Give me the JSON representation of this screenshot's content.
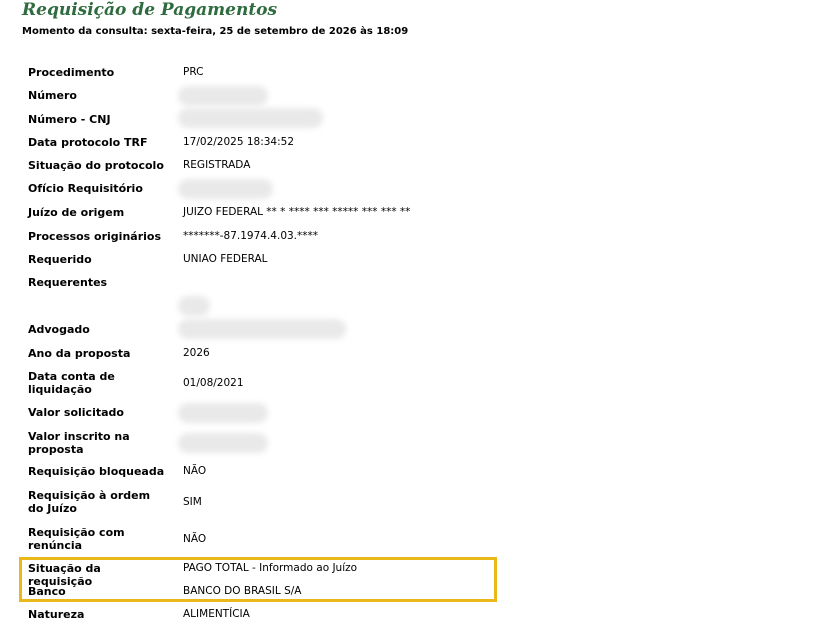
{
  "header": {
    "title": "Requisição de Pagamentos",
    "consulta": "Momento da consulta: sexta-feira, 25 de setembro de 2026 às 18:09"
  },
  "fields": {
    "procedimento": {
      "label": "Procedimento",
      "value": "PRC"
    },
    "numero": {
      "label": "Número",
      "value": ""
    },
    "numero_cnj": {
      "label": "Número - CNJ",
      "value": ""
    },
    "data_protocolo": {
      "label": "Data protocolo TRF",
      "value": "17/02/2025 18:34:52"
    },
    "situacao_protocolo": {
      "label": "Situação do protocolo",
      "value": "REGISTRADA"
    },
    "oficio": {
      "label": "Ofício Requisitório",
      "value": ""
    },
    "juizo_origem": {
      "label": "Juízo de origem",
      "value": "JUIZO FEDERAL ** * **** *** ***** *** *** **"
    },
    "processos_originarios": {
      "label": "Processos originários",
      "value": "*******-87.1974.4.03.****"
    },
    "requerido": {
      "label": "Requerido",
      "value": "UNIAO FEDERAL"
    },
    "requerentes": {
      "label": "Requerentes",
      "value": ""
    },
    "advogado": {
      "label": "Advogado",
      "value": ""
    },
    "ano_proposta": {
      "label": "Ano da proposta",
      "value": "2026"
    },
    "data_conta": {
      "label": "Data conta de liquidação",
      "value": "01/08/2021"
    },
    "valor_solicitado": {
      "label": "Valor solicitado",
      "value": ""
    },
    "valor_inscrito": {
      "label": "Valor inscrito na proposta",
      "value": ""
    },
    "requisicao_bloqueada": {
      "label": "Requisição bloqueada",
      "value": "NÃO"
    },
    "requisicao_ordem": {
      "label": "Requisição à ordem do Juízo",
      "value": "SIM"
    },
    "requisicao_renuncia": {
      "label": "Requisição com renúncia",
      "value": "NÃO"
    },
    "situacao_requisicao": {
      "label": "Situação da requisição",
      "value": "PAGO TOTAL - Informado ao Juízo"
    },
    "banco": {
      "label": "Banco",
      "value": "BANCO DO BRASIL S/A"
    },
    "natureza": {
      "label": "Natureza",
      "value": "ALIMENTÍCIA"
    }
  },
  "colors": {
    "title": "#2e6b3f",
    "highlight": "#eab818"
  }
}
